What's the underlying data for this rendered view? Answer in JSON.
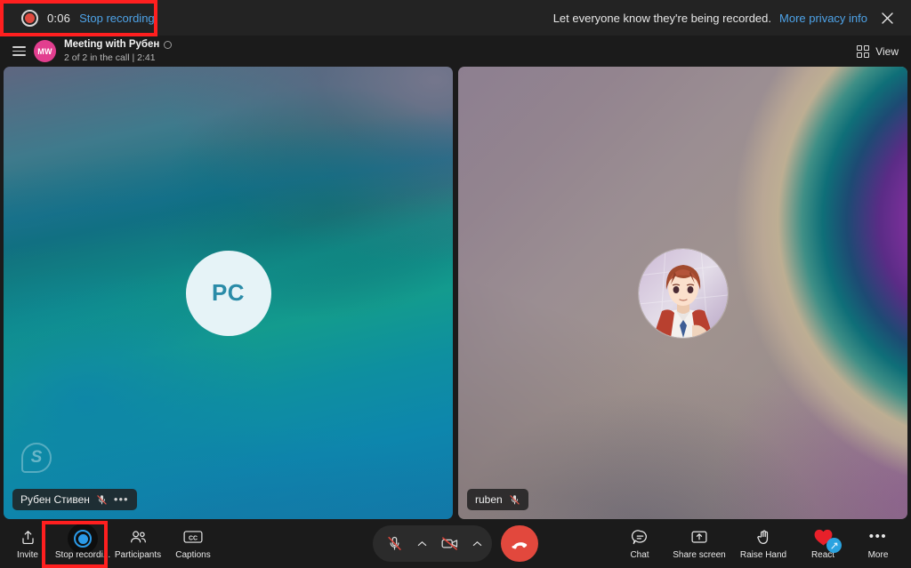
{
  "recording_bar": {
    "timer": "0:06",
    "stop_label": "Stop recording",
    "rec_icon": "record-dot-icon"
  },
  "notification": {
    "message": "Let everyone know they're being recorded.",
    "link_label": "More privacy info",
    "close_icon": "close-icon"
  },
  "meeting_header": {
    "menu_icon": "hamburger-icon",
    "avatar_initials": "MW",
    "title": "Meeting with Рубен",
    "globe_icon": "globe-icon",
    "subtitle": "2 of 2 in the call | 2:41",
    "view_label": "View",
    "view_icon": "grid-view-icon"
  },
  "tiles": [
    {
      "id": "tile-left",
      "avatar_type": "initials",
      "avatar_initials": "PC",
      "watermark": "S",
      "watermark_name": "skype-watermark",
      "name": "Рубен Стивен",
      "mic_icon": "mic-off-icon",
      "overflow_icon": "more-options-icon",
      "muted": true
    },
    {
      "id": "tile-right",
      "avatar_type": "photo",
      "avatar_initials": "",
      "name": "ruben",
      "mic_icon": "mic-off-icon",
      "muted": true
    }
  ],
  "toolbar": {
    "left_items": [
      {
        "label": "Invite",
        "icon": "share-upload-icon"
      },
      {
        "label": "Stop recordi...",
        "icon": "stop-recording-icon",
        "highlighted": true
      },
      {
        "label": "Participants",
        "icon": "participants-icon"
      },
      {
        "label": "Captions",
        "icon": "captions-cc-icon"
      }
    ],
    "center": {
      "mic_icon": "mic-muted-icon",
      "mic_chevron_icon": "chevron-up-icon",
      "camera_icon": "camera-off-icon",
      "camera_chevron_icon": "chevron-up-icon",
      "hangup_icon": "end-call-icon"
    },
    "right_items": [
      {
        "label": "Chat",
        "icon": "chat-bubble-icon"
      },
      {
        "label": "Share screen",
        "icon": "share-screen-icon"
      },
      {
        "label": "Raise Hand",
        "icon": "raise-hand-icon"
      },
      {
        "label": "React",
        "icon": "heart-react-icon"
      },
      {
        "label": "More",
        "icon": "more-dots-icon"
      }
    ]
  },
  "colors": {
    "accent_link": "#4ea3e8",
    "record_red": "#e04a3f",
    "highlight_box": "#ff1f1f",
    "hangup_red": "#e2483d",
    "avatar_pink": "#e23e8f",
    "react_heart": "#e8202a",
    "rec_button_blue": "#2b9ae8"
  }
}
